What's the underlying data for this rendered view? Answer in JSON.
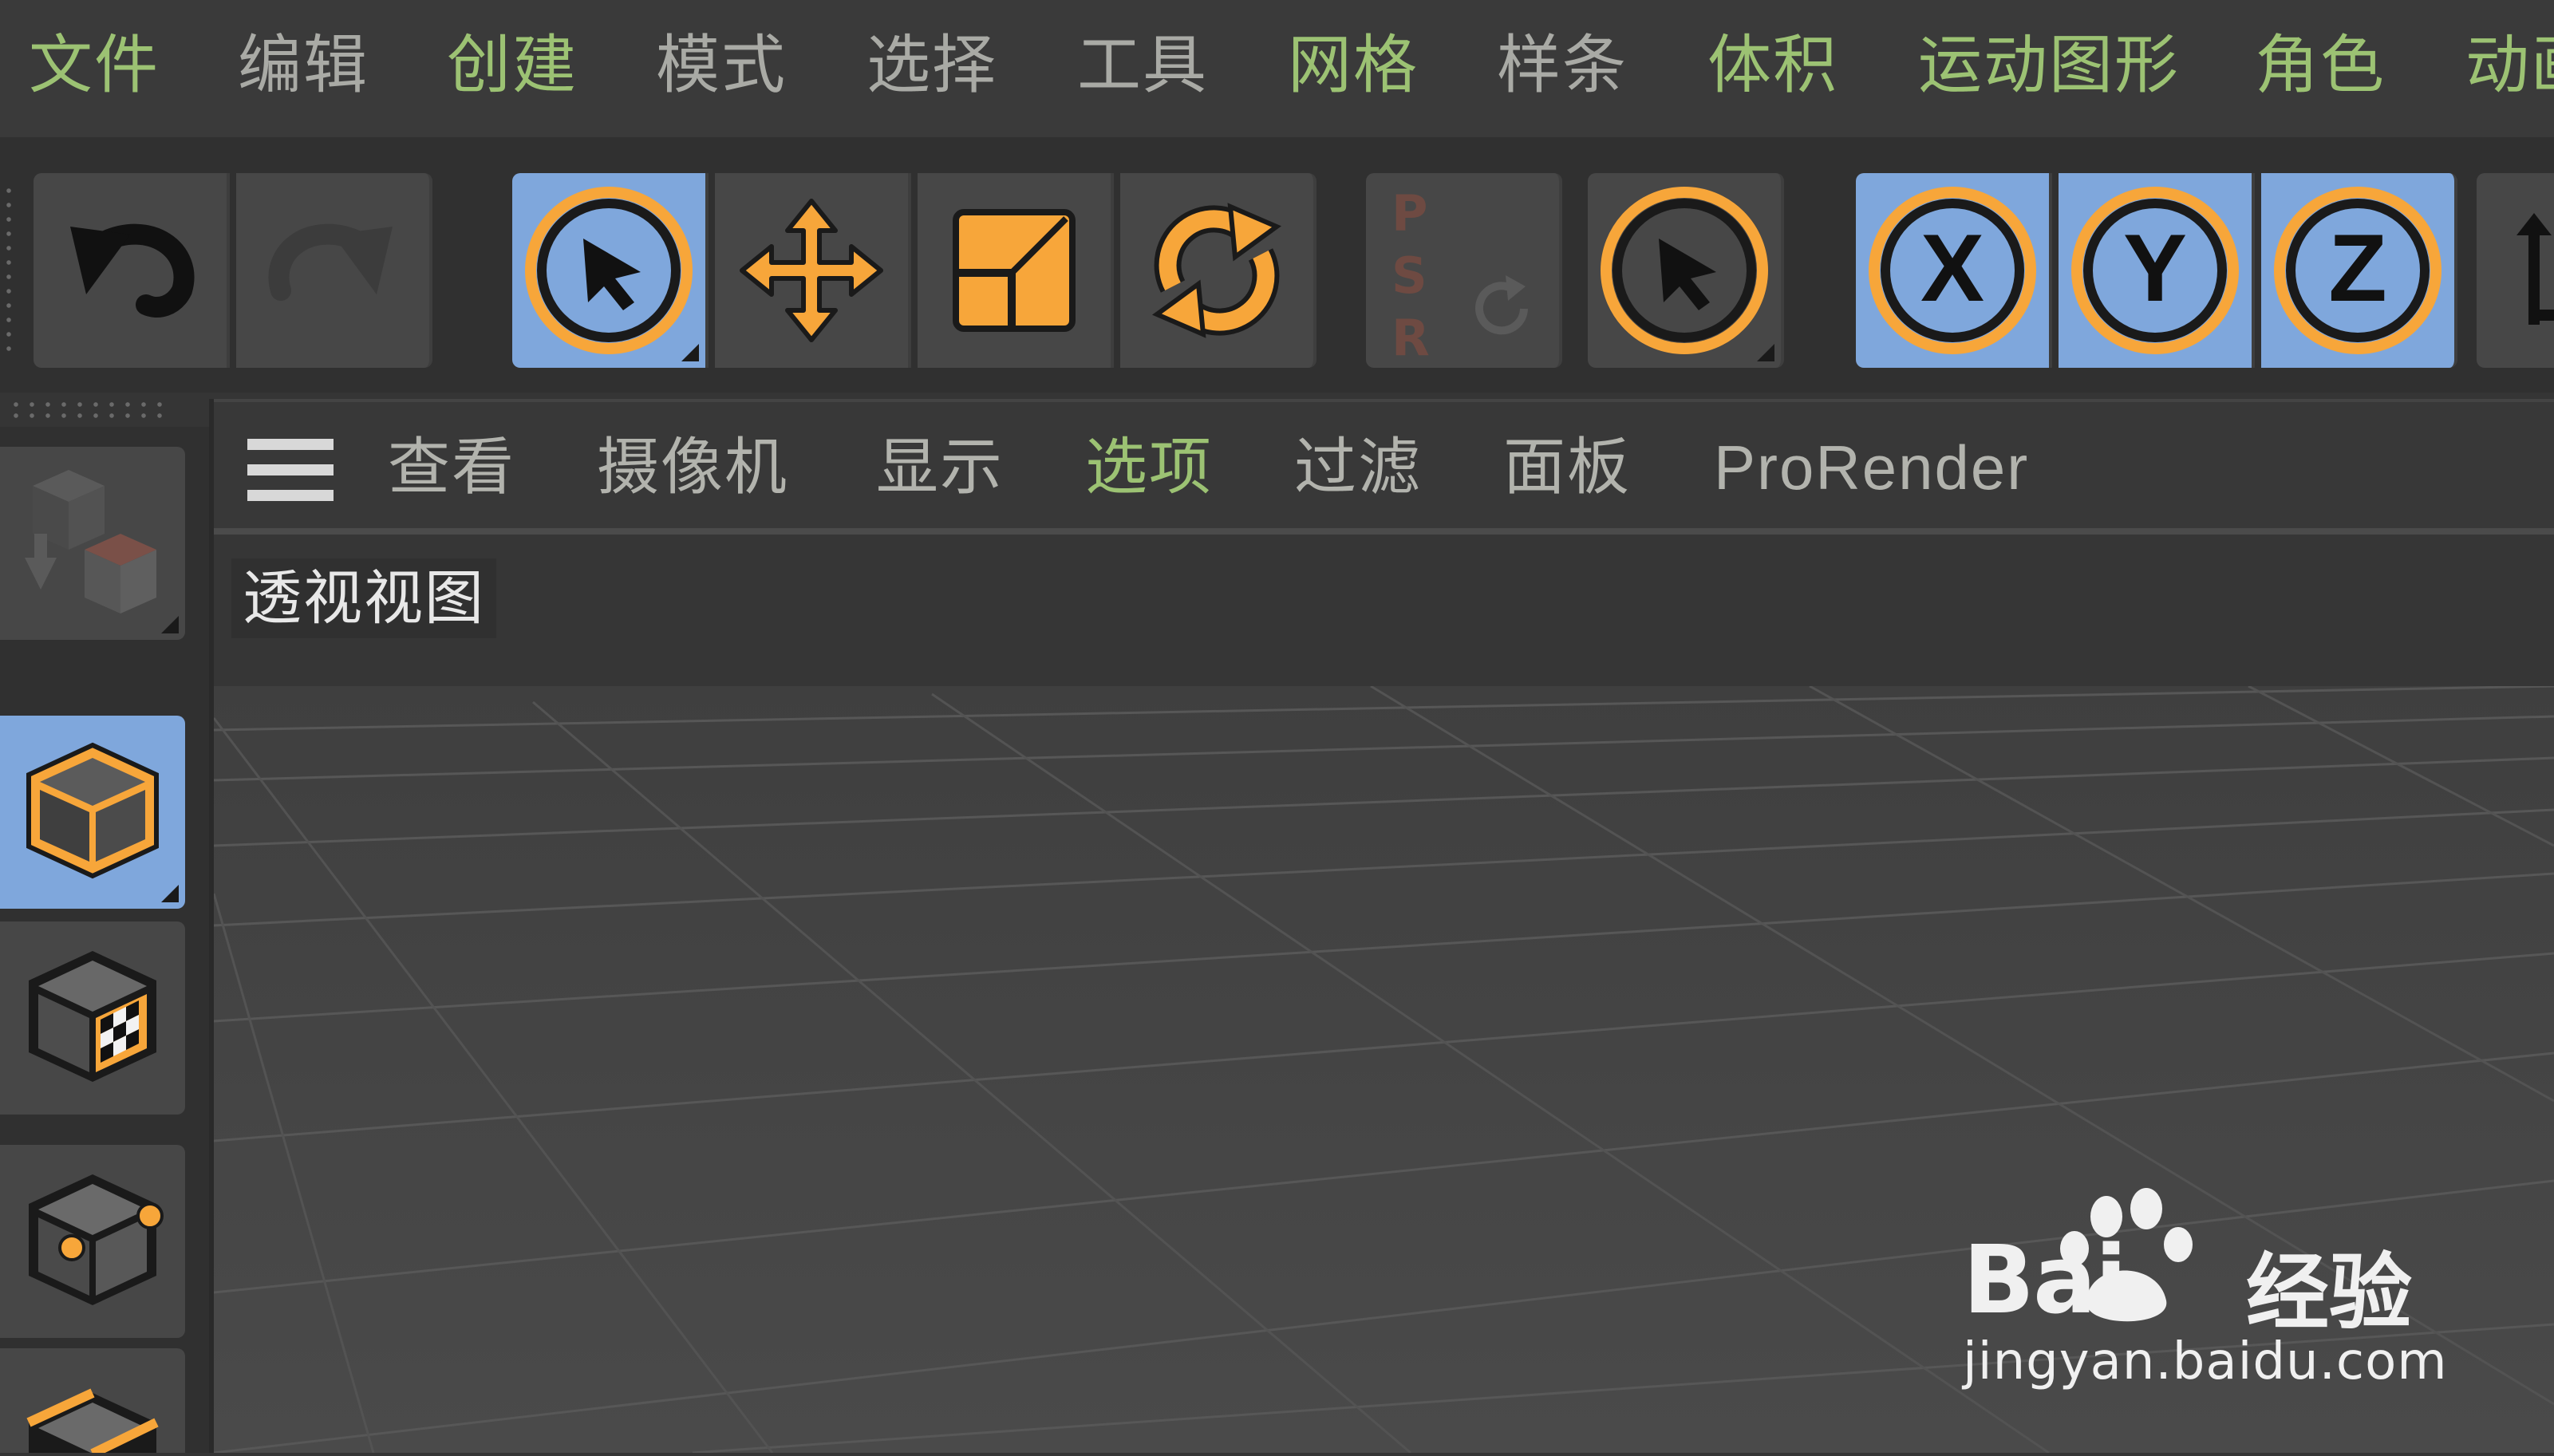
{
  "menubar": {
    "items": [
      {
        "label": "文件",
        "tone": "green"
      },
      {
        "label": "编辑",
        "tone": "gray"
      },
      {
        "label": "创建",
        "tone": "green"
      },
      {
        "label": "模式",
        "tone": "gray"
      },
      {
        "label": "选择",
        "tone": "gray"
      },
      {
        "label": "工具",
        "tone": "gray"
      },
      {
        "label": "网格",
        "tone": "green"
      },
      {
        "label": "样条",
        "tone": "gray"
      },
      {
        "label": "体积",
        "tone": "green"
      },
      {
        "label": "运动图形",
        "tone": "green"
      },
      {
        "label": "角色",
        "tone": "green"
      },
      {
        "label": "动画",
        "tone": "green"
      }
    ]
  },
  "toolbar": {
    "psr_letters": [
      "P",
      "S",
      "R"
    ],
    "axis_x": "X",
    "axis_y": "Y",
    "axis_z": "Z"
  },
  "viewport": {
    "menu": {
      "items": [
        {
          "label": "查看",
          "tone": "gray"
        },
        {
          "label": "摄像机",
          "tone": "gray"
        },
        {
          "label": "显示",
          "tone": "gray"
        },
        {
          "label": "选项",
          "tone": "green"
        },
        {
          "label": "过滤",
          "tone": "gray"
        },
        {
          "label": "面板",
          "tone": "gray"
        },
        {
          "label": "ProRender",
          "tone": "gray"
        }
      ]
    },
    "title": "透视视图"
  },
  "watermark": {
    "brand": "Bai",
    "brand_suffix": "经验",
    "url": "jingyan.baidu.com"
  },
  "colors": {
    "accent_orange": "#f7a63a",
    "selected_blue": "#7fa7dc",
    "menu_green": "#9cc273",
    "menu_gray": "#a9aaa5"
  }
}
